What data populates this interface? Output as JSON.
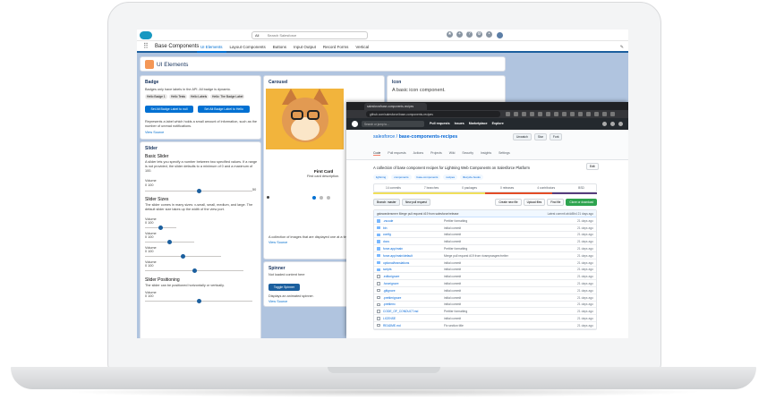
{
  "salesforce": {
    "search_scope": "All",
    "search_placeholder": "Search Salesforce",
    "app_name": "Base Components",
    "nav_tabs": [
      "UI Elements",
      "Layout Components",
      "Buttons",
      "Input Output",
      "Record Forms",
      "Vertical"
    ],
    "page_title": "UI Elements",
    "badge_card": {
      "title": "Badge",
      "desc": "Badges only have labels in the API. All badge is dynamic.",
      "badges": [
        "Hello Badge 1",
        "Hello Tests",
        "Hello Labels",
        "Hello: The Badge Label"
      ],
      "btn_null": "Set Alt Badge Label to null",
      "btn_hello": "Set Alt Badge Label to Hello",
      "note": "Represents a label which holds a small amount of information, such as the number of unread notifications.",
      "view_source": "View Source"
    },
    "slider_card": {
      "title": "Slider",
      "basic_title": "Basic Slider",
      "basic_desc": "A slider lets you specify a number between two specified values. If a range is not provided, the slider defaults to a minimum of 0 and a maximum of 100.",
      "volume": "Volume",
      "range": "0 100",
      "basic_value": "50",
      "sizes_title": "Slider Sizes",
      "sizes_desc": "The slider comes in many sizes: x-small, small, medium, and large. The default slider size takes up the width of the view port.",
      "pos_title": "Slider Positioning",
      "pos_desc": "The slider can be positioned horizontally or vertically."
    },
    "carousel_card": {
      "title": "Carousel",
      "image_title": "First Card",
      "image_desc": "First card description.",
      "desc": "A collection of images that are displayed one at a time.",
      "view_source": "View Source"
    },
    "spinner_card": {
      "title": "Spinner",
      "desc": "Not loaded content here",
      "btn": "Toggle Spinner",
      "note": "Displays an animated spinner.",
      "view_source": "View Source"
    },
    "icon_card": {
      "title": "Icon",
      "desc": "A basic icon component."
    }
  },
  "github": {
    "tab_title": "salesforce/base-components-recipes",
    "url": "github.com/salesforce/base-components-recipes",
    "search_placeholder": "Search or jump to...",
    "menu": [
      "Pull requests",
      "Issues",
      "Marketplace",
      "Explore"
    ],
    "repo_owner": "salesforce",
    "repo_name": "base-components-recipes",
    "actions": [
      "Unwatch",
      "Star",
      "Fork"
    ],
    "repo_tabs": [
      "Code",
      "Pull requests",
      "Actions",
      "Projects",
      "Wiki",
      "Security",
      "Insights",
      "Settings"
    ],
    "description": "A collection of base component recipes for Lightning Web Components on Salesforce Platform",
    "edit": "Edit",
    "topics": [
      "lightning",
      "components",
      "base-components",
      "recipes",
      "lifecycle-hooks"
    ],
    "stats": [
      "14 commits",
      "7 branches",
      "0 packages",
      "0 releases",
      "4 contributors",
      "BSD"
    ],
    "branch": "Branch: master",
    "new_pr": "New pull request",
    "toolbar_btns": [
      "Create new file",
      "Upload files",
      "Find file"
    ],
    "clone": "Clone or download",
    "commit_msg": "gstewardersmerr Merge pull request #19 from salesforce/release",
    "commit_right": "Latest commit ab4d5b4 21 days ago",
    "files": [
      {
        "name": ".vscode",
        "msg": "Prettier formatting",
        "ago": "21 days ago",
        "dir": true
      },
      {
        "name": "bin",
        "msg": "initial commit",
        "ago": "21 days ago",
        "dir": true
      },
      {
        "name": "config",
        "msg": "initial commit",
        "ago": "21 days ago",
        "dir": true
      },
      {
        "name": "docs",
        "msg": "initial commit",
        "ago": "21 days ago",
        "dir": true
      },
      {
        "name": "force-app/main",
        "msg": "Prettier formatting",
        "ago": "21 days ago",
        "dir": true
      },
      {
        "name": "force-app/main/default",
        "msg": "Merge pull request #19 from rivamprasgrer/netter",
        "ago": "21 days ago",
        "dir": true
      },
      {
        "name": "optional/translations",
        "msg": "initial commit",
        "ago": "21 days ago",
        "dir": true
      },
      {
        "name": "scripts",
        "msg": "initial commit",
        "ago": "21 days ago",
        "dir": true
      },
      {
        "name": ".editorignore",
        "msg": "initial commit",
        "ago": "21 days ago",
        "dir": false
      },
      {
        "name": ".forceignore",
        "msg": "initial commit",
        "ago": "21 days ago",
        "dir": false
      },
      {
        "name": ".gitignore",
        "msg": "initial commit",
        "ago": "21 days ago",
        "dir": false
      },
      {
        "name": ".prettierignore",
        "msg": "initial commit",
        "ago": "21 days ago",
        "dir": false
      },
      {
        "name": ".prettierrc",
        "msg": "initial commit",
        "ago": "21 days ago",
        "dir": false
      },
      {
        "name": "CODE_OF_CONDUCT.md",
        "msg": "Prettier formatting",
        "ago": "21 days ago",
        "dir": false
      },
      {
        "name": "LICENSE",
        "msg": "initial commit",
        "ago": "21 days ago",
        "dir": false
      },
      {
        "name": "README.md",
        "msg": "Fix section title",
        "ago": "21 days ago",
        "dir": false
      }
    ]
  },
  "colors": {
    "sf_blue": "#0070d2",
    "gh_dark": "#24292e",
    "gh_link": "#0366d6"
  }
}
